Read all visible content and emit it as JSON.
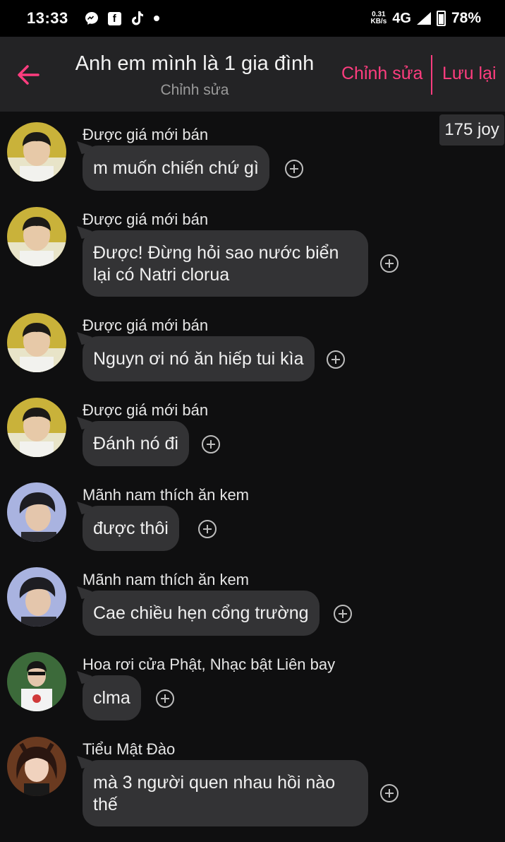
{
  "status_bar": {
    "time": "13:33",
    "icons": [
      "messenger-icon",
      "facebook-icon",
      "tiktok-icon",
      "dot-icon"
    ],
    "speed_value": "0.31",
    "speed_unit": "KB/s",
    "network": "4G",
    "battery": "78%"
  },
  "header": {
    "title": "Anh em mình là 1 gia đình",
    "subtitle": "Chỉnh sửa",
    "edit_label": "Chỉnh sửa",
    "save_label": "Lưu lại",
    "accent": "#ff3d7f"
  },
  "joy_badge": "175 joy",
  "messages": [
    {
      "sender": "Được giá mới bán",
      "text": "m muốn chiến chứ gì"
    },
    {
      "sender": "Được giá mới bán",
      "text": "Được! Đừng hỏi sao nước biển lại có Natri clorua"
    },
    {
      "sender": "Được giá mới bán",
      "text": "Nguyn ơi nó ăn hiếp tui kìa"
    },
    {
      "sender": "Được giá mới bán",
      "text": "Đánh nó đi"
    },
    {
      "sender": "Mãnh nam thích ăn kem",
      "text": "được thôi"
    },
    {
      "sender": "Mãnh nam thích ăn kem",
      "text": "Cae chiều hẹn cổng trường"
    },
    {
      "sender": "Hoa rơi cửa Phật, Nhạc bật Liên bay",
      "text": "clma"
    },
    {
      "sender": "Tiểu Mật Đào",
      "text": "mà 3 người quen nhau hồi nào thế"
    }
  ]
}
